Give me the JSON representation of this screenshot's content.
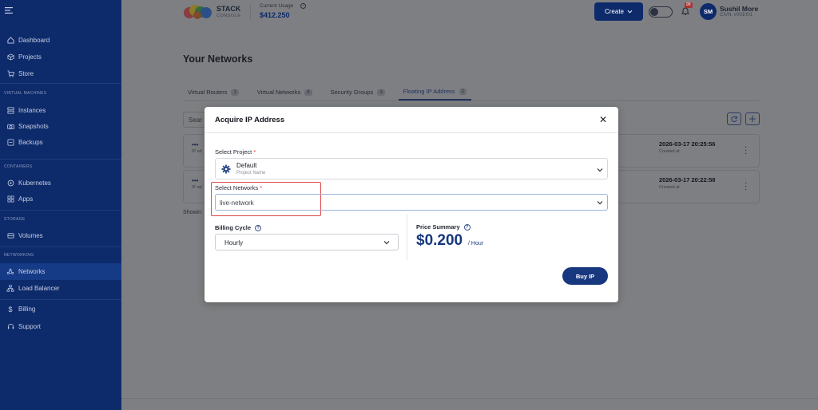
{
  "sidebar": {
    "items": [
      {
        "label": "Dashboard",
        "icon": "home-icon"
      },
      {
        "label": "Projects",
        "icon": "cube-icon"
      },
      {
        "label": "Store",
        "icon": "cart-icon"
      },
      {
        "label": "Instances",
        "icon": "server-icon"
      },
      {
        "label": "Snapshots",
        "icon": "camera-icon"
      },
      {
        "label": "Backups",
        "icon": "backup-icon"
      },
      {
        "label": "Kubernetes",
        "icon": "kubernetes-icon"
      },
      {
        "label": "Apps",
        "icon": "apps-icon"
      },
      {
        "label": "Volumes",
        "icon": "volume-icon"
      },
      {
        "label": "Networks",
        "icon": "network-icon"
      },
      {
        "label": "Load Balancer",
        "icon": "load-balancer-icon"
      },
      {
        "label": "Billing",
        "icon": "dollar-icon"
      },
      {
        "label": "Support",
        "icon": "headset-icon"
      }
    ],
    "sections": {
      "virtual_machines": "VIRTUAL MACHINES",
      "containers": "CONTAINERS",
      "storage": "STORAGE",
      "networking": "NETWORKING"
    }
  },
  "header": {
    "logo_title": "STACK",
    "logo_subtitle": "CONSOLE",
    "usage_label": "Current Usage",
    "usage_value": "$412.250",
    "create_label": "Create",
    "notification_count": "99",
    "avatar_initials": "SM",
    "user_name": "Sushil More",
    "user_id": "CIVN: #001001"
  },
  "main": {
    "title": "Your Networks",
    "tabs": [
      {
        "label": "Virtual Routers",
        "count": "1"
      },
      {
        "label": "Virtual Networks",
        "count": "4"
      },
      {
        "label": "Security Groups",
        "count": "3"
      },
      {
        "label": "Floating IP Address",
        "count": "2"
      }
    ],
    "search_placeholder": "Sear",
    "rows": [
      {
        "address": "•••",
        "address_label": "IP ad",
        "date": "2026-03-17 20:25:56",
        "date_label": "Created at"
      },
      {
        "address": "•••",
        "address_label": "IP ad",
        "date": "2026-03-17 20:22:58",
        "date_label": "Created at"
      }
    ],
    "showing_text": "Showin"
  },
  "modal": {
    "title": "Acquire IP Address",
    "project_label": "Select Project",
    "project_name": "Default",
    "project_sub": "Project Name",
    "networks_label": "Select Networks",
    "network_value": "live-network",
    "billing_label": "Billing Cycle",
    "billing_value": "Hourly",
    "price_label": "Price Summary",
    "price_value": "$0.200",
    "price_unit": "/ Hour",
    "buy_label": "Buy IP",
    "required_mark": "*"
  }
}
